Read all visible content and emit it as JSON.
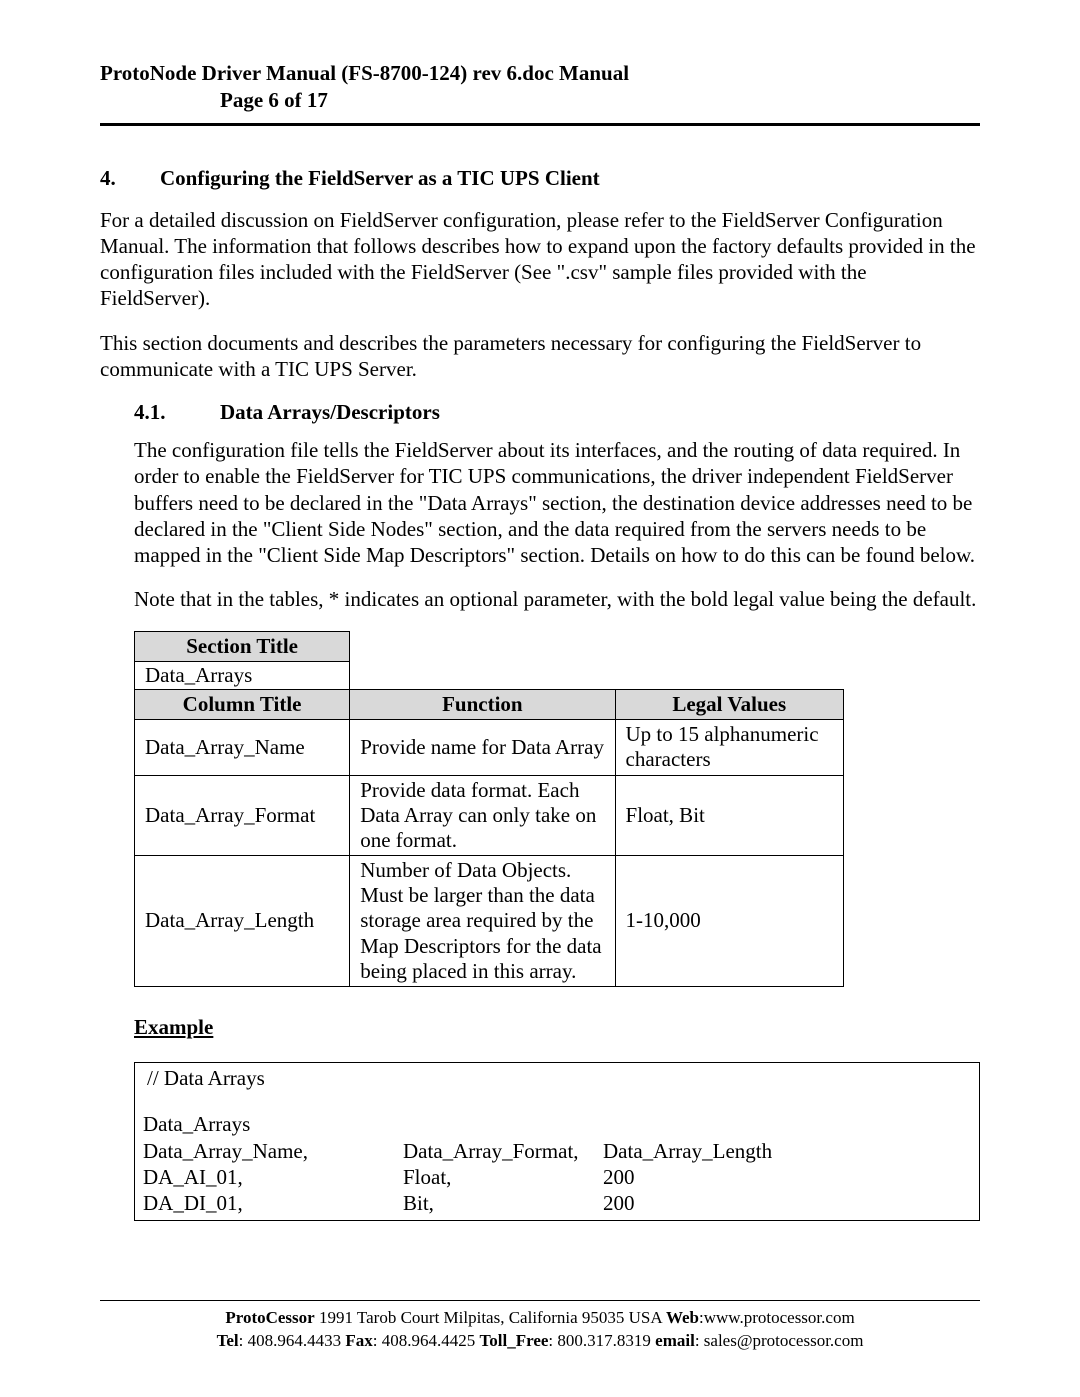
{
  "header": {
    "line1": "ProtoNode Driver Manual (FS-8700-124) rev 6.doc Manual",
    "line2": "Page 6 of 17"
  },
  "section": {
    "num": "4.",
    "title": "Configuring the FieldServer as a TIC UPS Client"
  },
  "para1": "For a detailed discussion on FieldServer configuration, please refer to the FieldServer Configuration Manual.  The information that follows describes how to expand upon the factory defaults provided in the configuration files included with the FieldServer (See \".csv\" sample files provided with the FieldServer).",
  "para2": "This section documents and describes the parameters necessary for configuring the FieldServer to communicate with a TIC UPS Server.",
  "subsection": {
    "num": "4.1.",
    "title": "Data Arrays/Descriptors"
  },
  "para3": "The configuration file tells the FieldServer about its interfaces, and the routing of data required.  In order to enable the FieldServer for TIC UPS communications, the driver independent FieldServer buffers need to be declared in the \"Data Arrays\" section, the destination device addresses need to be declared in the \"Client Side Nodes\" section, and the data required from the servers needs to be mapped in the \"Client Side Map Descriptors\" section.  Details on how to do this can be found below.",
  "para4": "Note that in the tables, * indicates an optional parameter, with the bold legal value being the default.",
  "table": {
    "section_title_hdr": "Section Title",
    "section_title_val": "Data_Arrays",
    "col_hdr": "Column Title",
    "func_hdr": "Function",
    "legal_hdr": "Legal Values",
    "rows": [
      {
        "col": "Data_Array_Name",
        "func": "Provide name for Data Array",
        "legal": "Up to 15 alphanumeric characters"
      },
      {
        "col": "Data_Array_Format",
        "func": "Provide data format. Each Data Array can only take on one format.",
        "legal": "Float, Bit"
      },
      {
        "col": "Data_Array_Length",
        "func": "Number of Data Objects. Must be larger than the data storage area required by the Map Descriptors for the data being placed in this array.",
        "legal": "1-10,000"
      }
    ]
  },
  "example": {
    "header": "Example",
    "comment": "//    Data Arrays",
    "block_title": "Data_Arrays",
    "cols": {
      "c1": "Data_Array_Name,",
      "c2": "Data_Array_Format,",
      "c3": "Data_Array_Length"
    },
    "rows": [
      {
        "c1": "DA_AI_01,",
        "c2": "Float,",
        "c3": "200"
      },
      {
        "c1": "DA_DI_01,",
        "c2": "Bit,",
        "c3": "200"
      }
    ]
  },
  "footer": {
    "brand": "ProtoCessor",
    "addr": " 1991 Tarob Court Milpitas, California 95035 USA  ",
    "web_lbl": "Web",
    "web_val": ":www.protocessor.com",
    "tel_lbl": "Tel",
    "tel_val": ": 408.964.4433  ",
    "fax_lbl": "Fax",
    "fax_val": ": 408.964.4425  ",
    "tollfree_lbl": "Toll_Free",
    "tollfree_val": ": 800.317.8319  ",
    "email_lbl": "email",
    "email_val": ": sales@protocessor.com"
  }
}
